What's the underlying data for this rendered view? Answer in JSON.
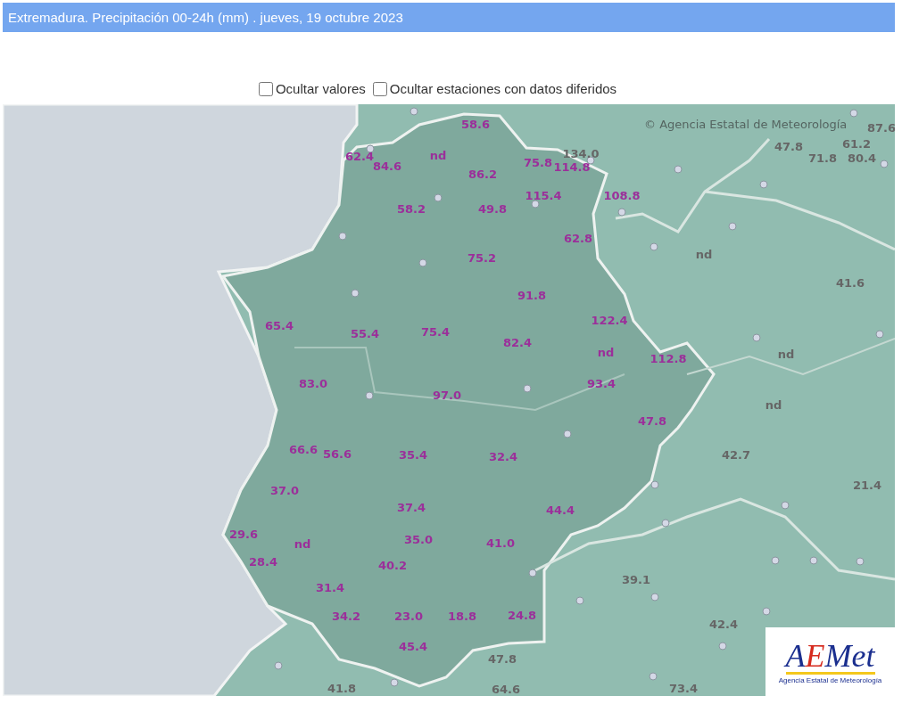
{
  "header": {
    "title": "Extremadura. Precipitación 00-24h (mm) . jueves, 19 octubre 2023"
  },
  "options": [
    {
      "label": "Ocultar valores",
      "checked": false
    },
    {
      "label": "Ocultar estaciones con datos diferidos",
      "checked": false
    }
  ],
  "map": {
    "attribution": "© Agencia Estatal de Meteorología",
    "stations": [
      {
        "value": "58.6",
        "kind": "region"
      },
      {
        "value": "62.4",
        "kind": "region"
      },
      {
        "value": "84.6",
        "kind": "region"
      },
      {
        "value": "nd",
        "kind": "region"
      },
      {
        "value": "86.2",
        "kind": "region"
      },
      {
        "value": "75.8",
        "kind": "region"
      },
      {
        "value": "114.8",
        "kind": "region"
      },
      {
        "value": "115.4",
        "kind": "region"
      },
      {
        "value": "108.8",
        "kind": "region"
      },
      {
        "value": "58.2",
        "kind": "region"
      },
      {
        "value": "49.8",
        "kind": "region"
      },
      {
        "value": "62.8",
        "kind": "region"
      },
      {
        "value": "75.2",
        "kind": "region"
      },
      {
        "value": "91.8",
        "kind": "region"
      },
      {
        "value": "122.4",
        "kind": "region"
      },
      {
        "value": "65.4",
        "kind": "region"
      },
      {
        "value": "55.4",
        "kind": "region"
      },
      {
        "value": "75.4",
        "kind": "region"
      },
      {
        "value": "82.4",
        "kind": "region"
      },
      {
        "value": "nd",
        "kind": "region"
      },
      {
        "value": "112.8",
        "kind": "region"
      },
      {
        "value": "83.0",
        "kind": "region"
      },
      {
        "value": "97.0",
        "kind": "region"
      },
      {
        "value": "93.4",
        "kind": "region"
      },
      {
        "value": "47.8",
        "kind": "region"
      },
      {
        "value": "66.6",
        "kind": "region"
      },
      {
        "value": "56.6",
        "kind": "region"
      },
      {
        "value": "35.4",
        "kind": "region"
      },
      {
        "value": "32.4",
        "kind": "region"
      },
      {
        "value": "37.0",
        "kind": "region"
      },
      {
        "value": "37.4",
        "kind": "region"
      },
      {
        "value": "44.4",
        "kind": "region"
      },
      {
        "value": "29.6",
        "kind": "region"
      },
      {
        "value": "nd",
        "kind": "region"
      },
      {
        "value": "35.0",
        "kind": "region"
      },
      {
        "value": "41.0",
        "kind": "region"
      },
      {
        "value": "28.4",
        "kind": "region"
      },
      {
        "value": "40.2",
        "kind": "region"
      },
      {
        "value": "31.4",
        "kind": "region"
      },
      {
        "value": "34.2",
        "kind": "region"
      },
      {
        "value": "23.0",
        "kind": "region"
      },
      {
        "value": "18.8",
        "kind": "region"
      },
      {
        "value": "24.8",
        "kind": "region"
      },
      {
        "value": "45.4",
        "kind": "region"
      },
      {
        "value": "134.0",
        "kind": "neighbour"
      },
      {
        "value": "47.8",
        "kind": "neighbour"
      },
      {
        "value": "61.2",
        "kind": "neighbour"
      },
      {
        "value": "71.8",
        "kind": "neighbour"
      },
      {
        "value": "80.4",
        "kind": "neighbour"
      },
      {
        "value": "87.6",
        "kind": "neighbour"
      },
      {
        "value": "nd",
        "kind": "neighbour"
      },
      {
        "value": "41.6",
        "kind": "neighbour"
      },
      {
        "value": "nd",
        "kind": "neighbour"
      },
      {
        "value": "nd",
        "kind": "neighbour"
      },
      {
        "value": "42.7",
        "kind": "neighbour"
      },
      {
        "value": "21.4",
        "kind": "neighbour"
      },
      {
        "value": "39.1",
        "kind": "neighbour"
      },
      {
        "value": "42.4",
        "kind": "neighbour"
      },
      {
        "value": "47.8",
        "kind": "neighbour"
      },
      {
        "value": "41.8",
        "kind": "neighbour"
      },
      {
        "value": "64.6",
        "kind": "neighbour"
      },
      {
        "value": "73.4",
        "kind": "neighbour"
      }
    ],
    "logo": {
      "wordmark": "AEMet",
      "caption": "Agencia Estatal de Meteorología"
    }
  }
}
